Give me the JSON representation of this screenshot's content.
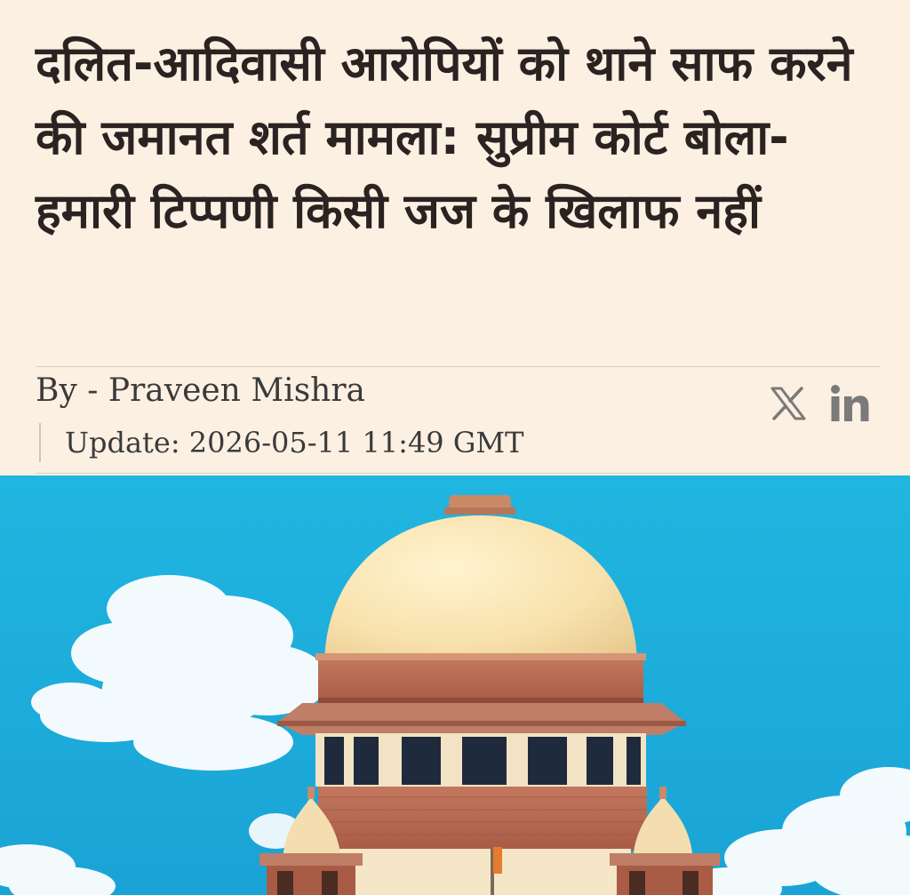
{
  "article": {
    "headline": "दलित-आदिवासी आरोपियों को थाने साफ करने की जमानत शर्त मामला: सुप्रीम कोर्ट बोला- हमारी टिप्पणी किसी जज के खिलाफ नहीं",
    "byline": "By - Praveen Mishra",
    "update": "Update: 2026-05-11 11:49 GMT"
  },
  "share": {
    "icons": [
      "x-icon",
      "linkedin-icon"
    ],
    "icon_color": "#7a7a7a"
  },
  "hero_image": {
    "subject": "Supreme Court of India building dome against blue sky"
  },
  "colors": {
    "background": "#fcf0e2",
    "headline": "#2b2222",
    "meta_text": "#3a3a3a",
    "sky": "#22b8e2"
  }
}
